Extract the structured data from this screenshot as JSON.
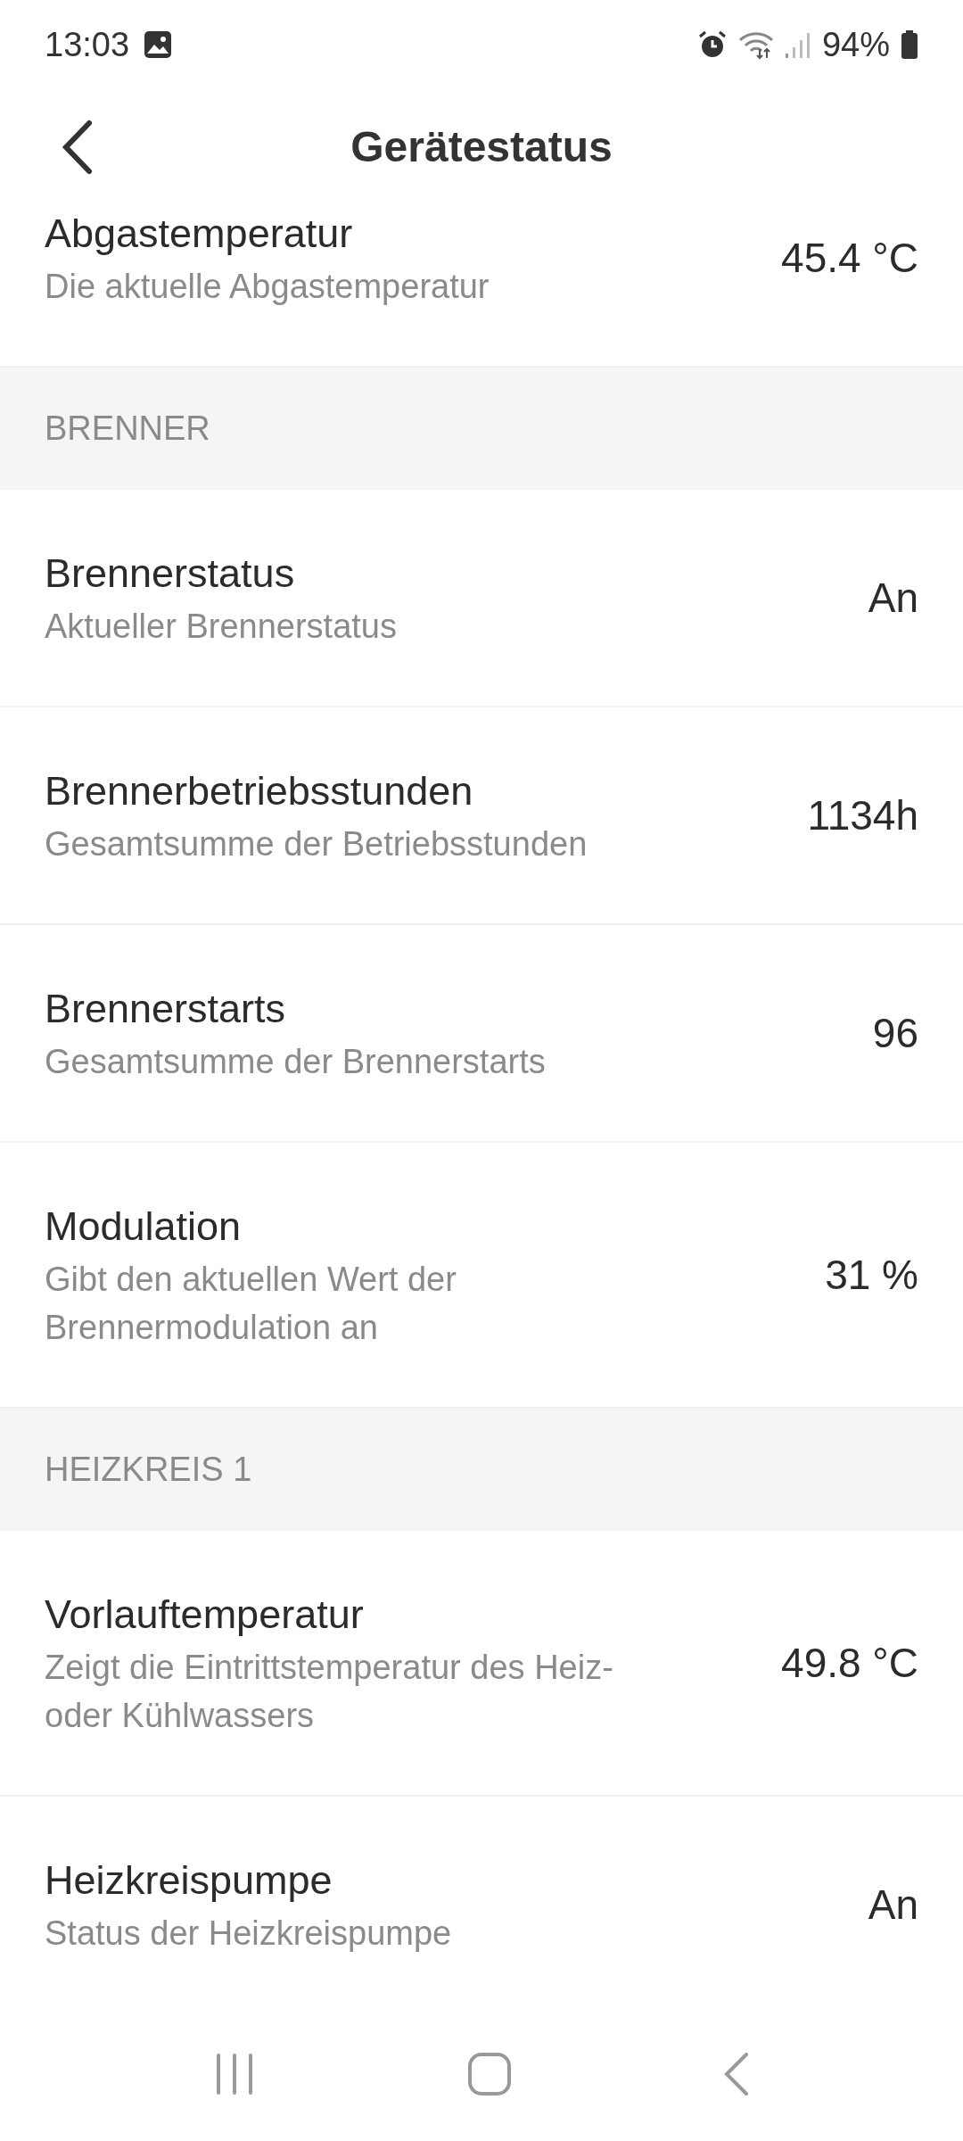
{
  "status_bar": {
    "time": "13:03",
    "battery": "94%"
  },
  "header": {
    "title": "Gerätestatus"
  },
  "entries": [
    {
      "kind": "item",
      "title": "Abgastemperatur",
      "description": "Die aktuelle Abgastemperatur",
      "value": "45.4 °C"
    },
    {
      "kind": "section",
      "title": "BRENNER"
    },
    {
      "kind": "item",
      "title": "Brennerstatus",
      "description": "Aktueller Brennerstatus",
      "value": "An"
    },
    {
      "kind": "item",
      "title": "Brennerbetriebsstunden",
      "description": "Gesamtsumme der Betriebsstunden",
      "value": "1134h"
    },
    {
      "kind": "item",
      "title": "Brennerstarts",
      "description": "Gesamtsumme der Brennerstarts",
      "value": "96"
    },
    {
      "kind": "item",
      "title": "Modulation",
      "description": "Gibt den aktuellen Wert der Brennermodulation an",
      "value": "31 %"
    },
    {
      "kind": "section",
      "title": "HEIZKREIS 1"
    },
    {
      "kind": "item",
      "title": "Vorlauftemperatur",
      "description": "Zeigt die Eintrittstemperatur des Heiz- oder Kühlwassers",
      "value": "49.8 °C"
    },
    {
      "kind": "item",
      "title": "Heizkreispumpe",
      "description": "Status der Heizkreispumpe",
      "value": "An"
    }
  ]
}
